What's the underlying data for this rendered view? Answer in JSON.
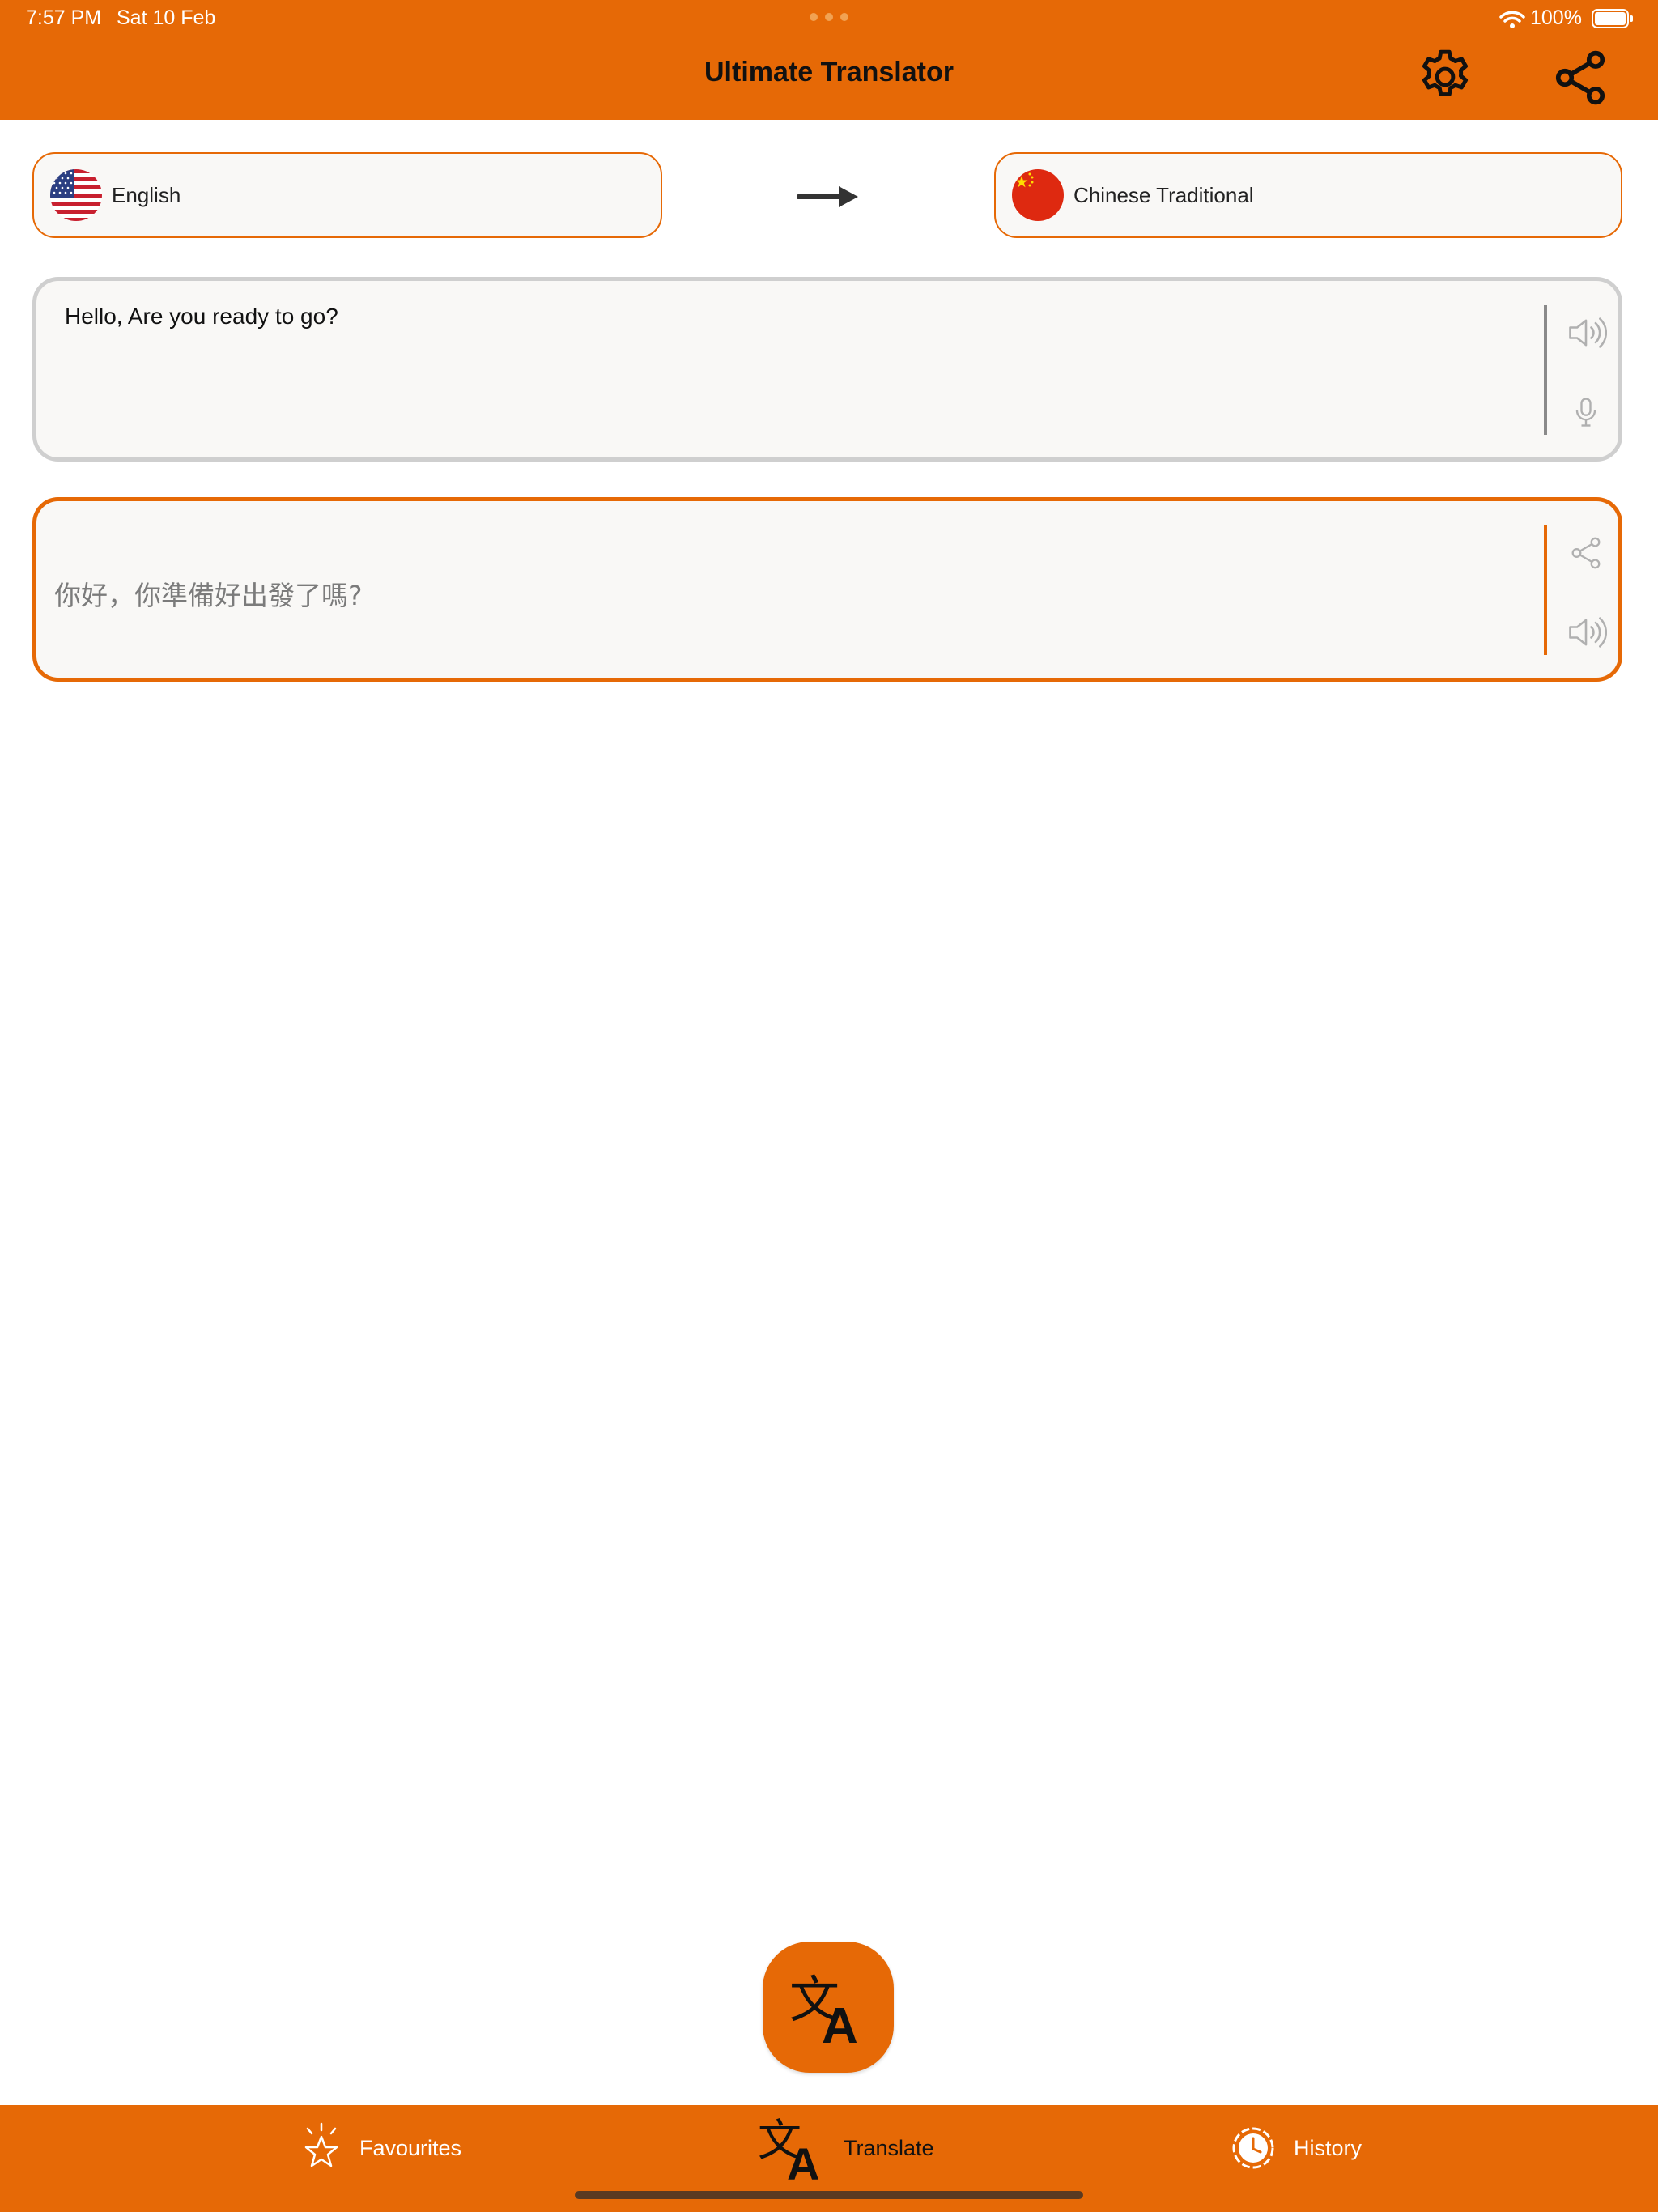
{
  "status_bar": {
    "time": "7:57 PM",
    "date": "Sat 10 Feb",
    "battery": "100%"
  },
  "header": {
    "title": "Ultimate Translator"
  },
  "languages": {
    "source": "English",
    "target": "Chinese Traditional"
  },
  "source": {
    "text": "Hello, Are you ready to go?"
  },
  "target": {
    "text": "你好，你準備好出發了嗎?"
  },
  "tabs": [
    {
      "label": "Favourites",
      "icon": "star-icon"
    },
    {
      "label": "Translate",
      "icon": "translate-icon",
      "active": true
    },
    {
      "label": "History",
      "icon": "history-icon"
    }
  ],
  "colors": {
    "accent": "#E66906",
    "muted_icon": "#B0B0B0"
  }
}
